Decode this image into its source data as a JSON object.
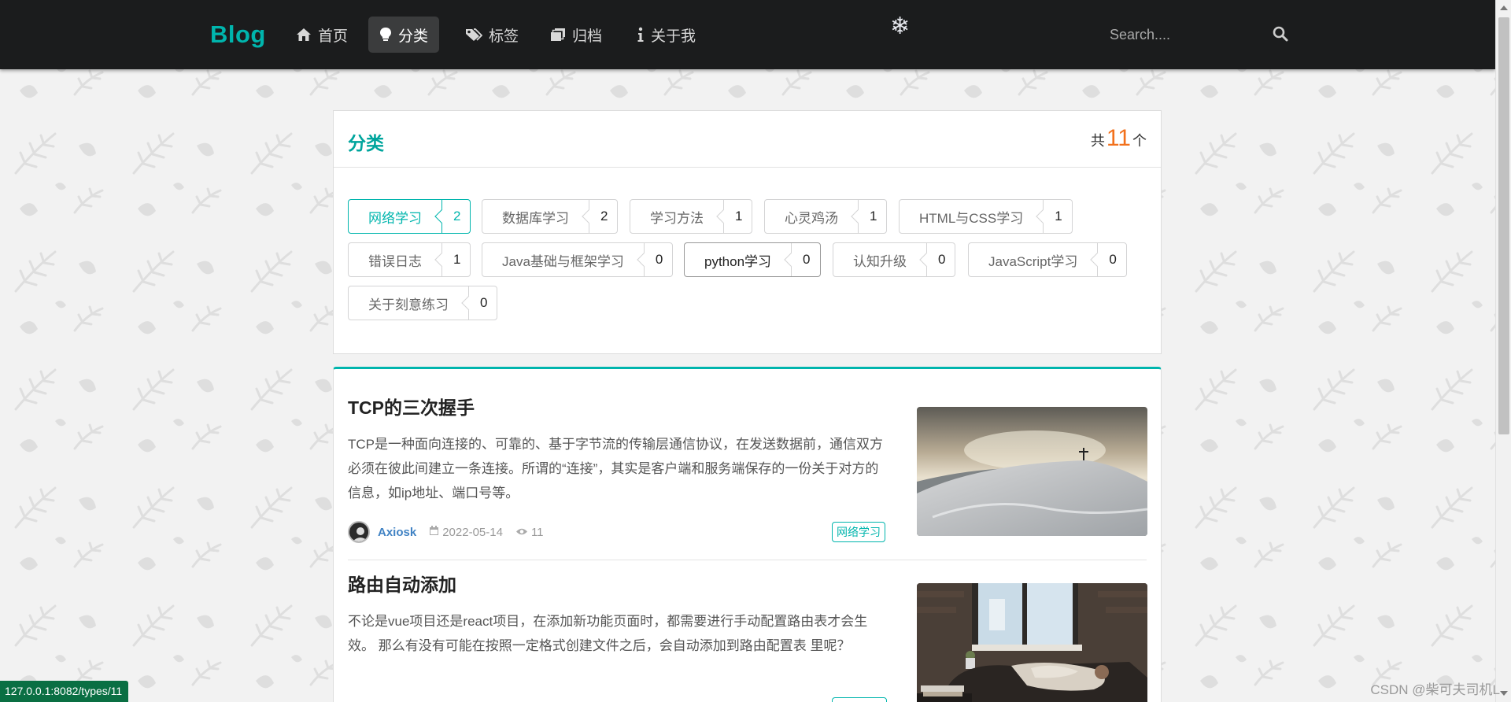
{
  "nav": {
    "brand": "Blog",
    "items": [
      {
        "label": "首页",
        "icon": "home-icon"
      },
      {
        "label": "分类",
        "icon": "lightbulb-icon",
        "active": true
      },
      {
        "label": "标签",
        "icon": "tags-icon"
      },
      {
        "label": "归档",
        "icon": "archive-icon"
      },
      {
        "label": "关于我",
        "icon": "info-icon"
      }
    ],
    "decoration": "❄",
    "search": {
      "placeholder": "Search....",
      "icon": "search-icon"
    }
  },
  "categories": {
    "title": "分类",
    "total_prefix": "共",
    "total": "11",
    "total_suffix": "个",
    "items": [
      {
        "name": "网络学习",
        "count": "2",
        "selected": true
      },
      {
        "name": "数据库学习",
        "count": "2"
      },
      {
        "name": "学习方法",
        "count": "1"
      },
      {
        "name": "心灵鸡汤",
        "count": "1"
      },
      {
        "name": "HTML与CSS学习",
        "count": "1"
      },
      {
        "name": "错误日志",
        "count": "1"
      },
      {
        "name": "Java基础与框架学习",
        "count": "0"
      },
      {
        "name": "python学习",
        "count": "0",
        "hover": true
      },
      {
        "name": "认知升级",
        "count": "0"
      },
      {
        "name": "JavaScript学习",
        "count": "0"
      },
      {
        "name": "关于刻意练习",
        "count": "0"
      }
    ]
  },
  "posts": [
    {
      "title": "TCP的三次握手",
      "excerpt": "TCP是一种面向连接的、可靠的、基于字节流的传输层通信协议，在发送数据前，通信双方必须在彼此间建立一条连接。所谓的“连接”，其实是客户端和服务端保存的一份关于对方的信息，如ip地址、端口号等。",
      "author": "Axiosk",
      "date": "2022-05-14",
      "views": "11",
      "tag": "网络学习",
      "image": "snowy-mountain-cross"
    },
    {
      "title": "路由自动添加",
      "excerpt": "不论是vue项目还是react项目，在添加新功能页面时，都需要进行手动配置路由表才会生效。 那么有没有可能在按照一定格式创建文件之后，会自动添加到路由配置表 里呢？",
      "author": "",
      "date": "",
      "views": "",
      "tag": "",
      "image": "person-sleeping-sofa"
    }
  ],
  "status_url": "127.0.0.1:8082/types/11",
  "watermark": "CSDN @柴可夫司机L",
  "colors": {
    "accent": "#00b5ad",
    "count": "#f2711c",
    "nav_bg": "#1b1c1d",
    "author": "#4183c4"
  }
}
